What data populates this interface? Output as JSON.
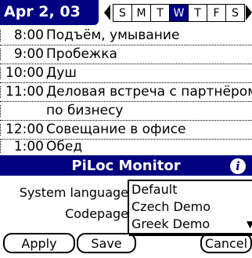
{
  "header": {
    "date": "Apr 2, 03",
    "weekdays": [
      "S",
      "M",
      "T",
      "W",
      "T",
      "F",
      "S"
    ],
    "selected_day_index": 3
  },
  "agenda": [
    {
      "time": "8:00",
      "text": "Подъём, умывание"
    },
    {
      "time": "9:00",
      "text": "Пробежка"
    },
    {
      "time": "10:00",
      "text": "Душ"
    },
    {
      "time": "11:00",
      "text": "Деловая встреча с партнёром"
    },
    {
      "time": "",
      "text": "по бизнесу"
    },
    {
      "time": "12:00",
      "text": "Совещание в офисе"
    },
    {
      "time": "1:00",
      "text": "Обед"
    }
  ],
  "dialog": {
    "title": "PiLoc Monitor",
    "info_icon": "i",
    "system_language_label": "System language",
    "codepage_label": "Codepage",
    "apply_label": "Apply",
    "save_label": "Save",
    "cancel_label": "Cancel"
  },
  "popup": {
    "options": [
      "Default",
      "Czech Demo",
      "Greek Demo"
    ],
    "scroll_arrow": "▼"
  },
  "colors": {
    "accent": "#000080",
    "background": "#ffffff",
    "text": "#000000"
  }
}
